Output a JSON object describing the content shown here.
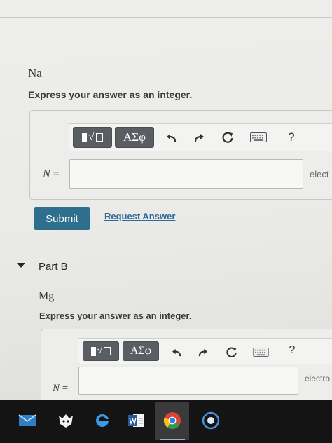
{
  "part_a": {
    "element": "Na",
    "instruction": "Express your answer as an integer.",
    "toolbar": {
      "greek_label": "ΑΣφ",
      "help_label": "?"
    },
    "variable": "N",
    "equals": "=",
    "input_value": "",
    "unit": "elect",
    "submit_label": "Submit",
    "request_label": "Request Answer"
  },
  "part_b": {
    "title": "Part B",
    "element": "Mg",
    "instruction": "Express your answer as an integer.",
    "toolbar": {
      "greek_label": "ΑΣφ",
      "help_label": "?"
    },
    "variable": "N",
    "equals": "=",
    "input_value": "",
    "unit": "electro"
  },
  "icons": {
    "template": "fraction-radical-icon",
    "undo": "undo-icon",
    "redo": "redo-icon",
    "reset": "reset-icon",
    "keyboard": "keyboard-icon"
  },
  "colors": {
    "submit_bg": "#2e6f8e",
    "link": "#2f6a98",
    "toolbar_button": "#5a5e63",
    "taskbar": "#141414"
  }
}
